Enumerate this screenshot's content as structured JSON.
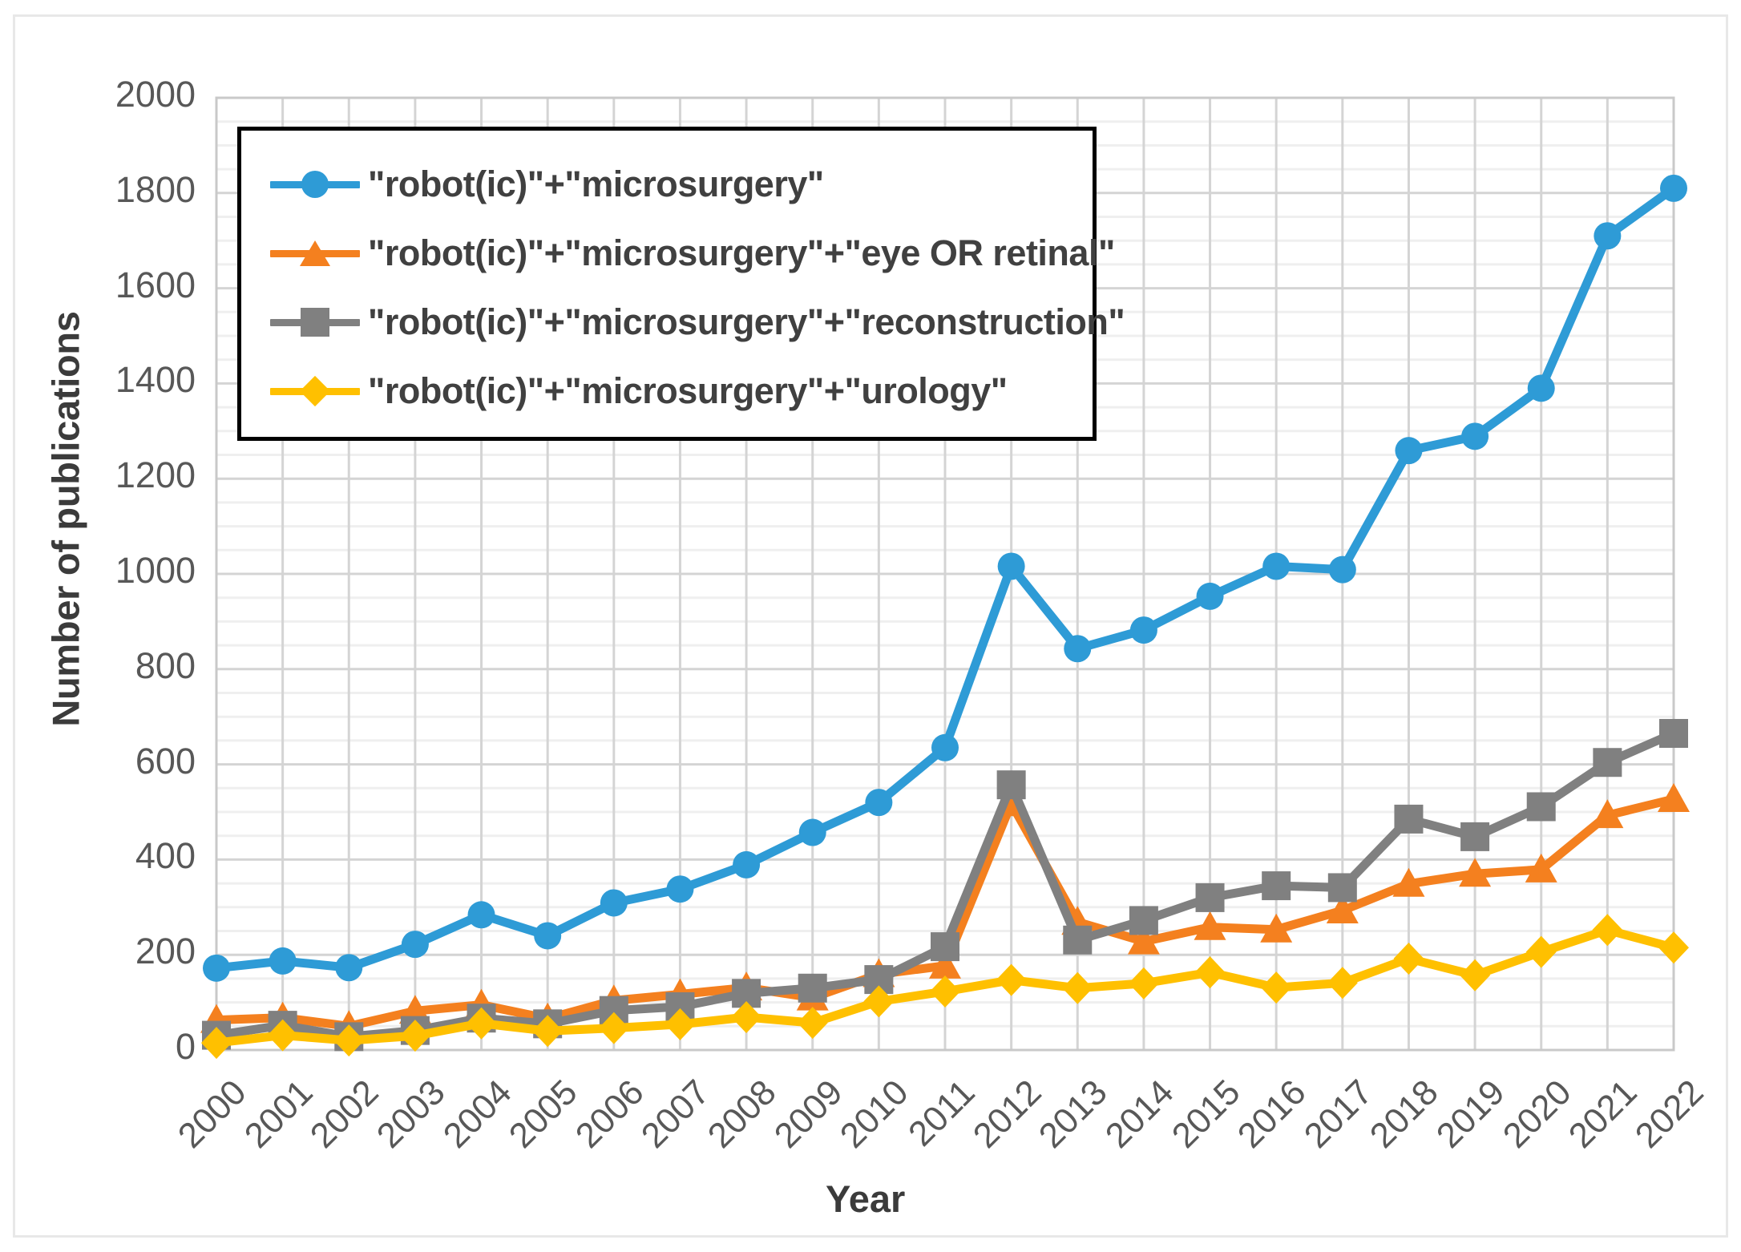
{
  "chart_data": {
    "type": "line",
    "title": "",
    "xlabel": "Year",
    "ylabel": "Number of publications",
    "grid": true,
    "legend_position": "upper-left inside plot",
    "xlim": [
      2000,
      2022
    ],
    "ylim": [
      0,
      2000
    ],
    "ytick_step": 200,
    "minor_ytick_step": 50,
    "categories": [
      "2000",
      "2001",
      "2002",
      "2003",
      "2004",
      "2005",
      "2006",
      "2007",
      "2008",
      "2009",
      "2010",
      "2011",
      "2012",
      "2013",
      "2014",
      "2015",
      "2016",
      "2017",
      "2018",
      "2019",
      "2020",
      "2021",
      "2022"
    ],
    "ytick_labels": [
      "0",
      "200",
      "400",
      "600",
      "800",
      "1000",
      "1200",
      "1400",
      "1600",
      "1800",
      "2000"
    ],
    "series": [
      {
        "name": "\"robot(ic)\"+\"microsurgery\"",
        "color": "#2E9BD6",
        "marker": "circle",
        "values": [
          172,
          187,
          173,
          222,
          284,
          240,
          309,
          338,
          389,
          457,
          520,
          635,
          1016,
          843,
          882,
          953,
          1016,
          1009,
          1259,
          1289,
          1390,
          1710,
          1810
        ]
      },
      {
        "name": "\"robot(ic)\"+\"microsurgery\"+\"eye OR retinal\"",
        "color": "#F4801F",
        "marker": "triangle",
        "values": [
          63,
          68,
          50,
          82,
          95,
          66,
          104,
          117,
          131,
          110,
          159,
          177,
          518,
          269,
          228,
          258,
          253,
          293,
          349,
          370,
          379,
          493,
          527
        ]
      },
      {
        "name": "\"robot(ic)\"+\"microsurgery\"+\"reconstruction\"",
        "color": "#808080",
        "marker": "square",
        "values": [
          31,
          52,
          28,
          41,
          67,
          55,
          83,
          91,
          119,
          130,
          148,
          217,
          557,
          231,
          272,
          320,
          345,
          341,
          485,
          448,
          511,
          604,
          665
        ]
      },
      {
        "name": "\"robot(ic)\"+\"microsurgery\"+\"urology\"",
        "color": "#FFC000",
        "marker": "diamond",
        "values": [
          15,
          31,
          20,
          30,
          56,
          40,
          46,
          54,
          69,
          57,
          102,
          123,
          147,
          130,
          140,
          163,
          131,
          141,
          192,
          157,
          206,
          252,
          215
        ]
      }
    ]
  },
  "axes": {
    "y_title": "Number of publications",
    "x_title": "Year"
  }
}
